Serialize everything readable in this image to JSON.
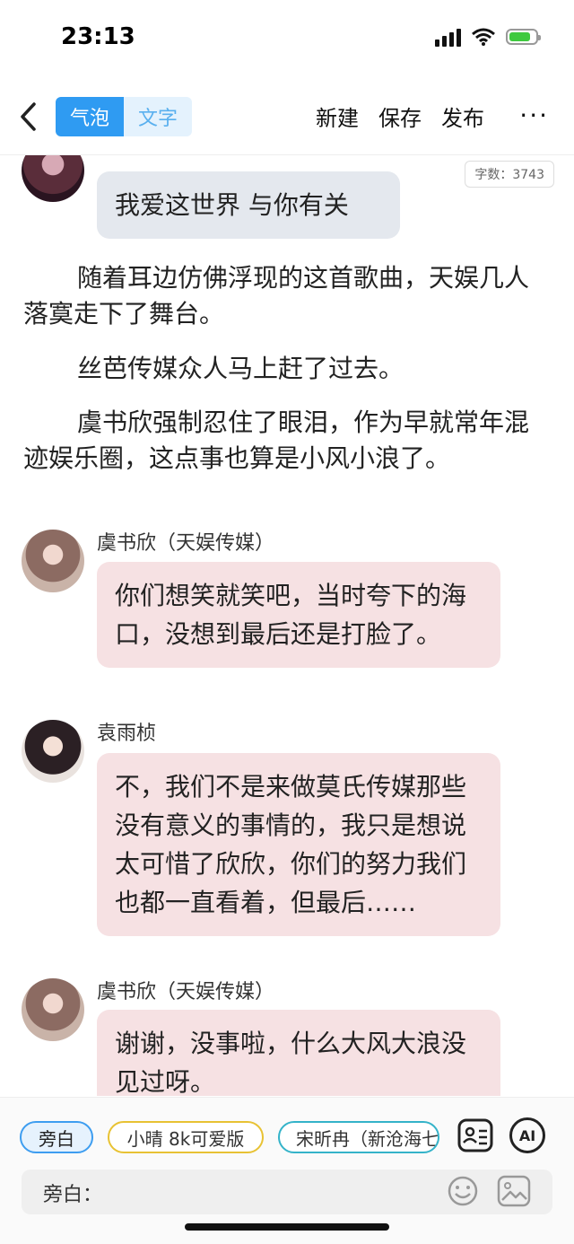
{
  "status": {
    "time": "23:13"
  },
  "header": {
    "seg_bubble": "气泡",
    "seg_text": "文字",
    "new_label": "新建",
    "save_label": "保存",
    "publish_label": "发布",
    "more_label": "···"
  },
  "word_count": "字数：3743",
  "messages": [
    {
      "bubble": "我爱这世界 与你有关"
    },
    {
      "name": "虞书欣（天娱传媒）",
      "text": "你们想笑就笑吧，当时夸下的海口，没想到最后还是打脸了。"
    },
    {
      "name": "袁雨桢",
      "text": "不，我们不是来做莫氏传媒那些没有意义的事情的，我只是想说太可惜了欣欣，你们的努力我们也都一直看着，但最后……"
    },
    {
      "name": "虞书欣（天娱传媒）",
      "text": "谢谢，没事啦，什么大风大浪没见过呀。"
    }
  ],
  "paragraphs": [
    "随着耳边仿佛浮现的这首歌曲，天娱几人落寞走下了舞台。",
    "丝芭传媒众人马上赶了过去。",
    "虞书欣强制忍住了眼泪，作为早就常年混迹娱乐圈，这点事也算是小风小浪了。"
  ],
  "bottom": {
    "chips": [
      "旁白",
      "小晴 8k可爱版",
      "宋昕冉（新沧海七"
    ],
    "ai_label": "AI",
    "input_label": "旁白："
  },
  "colors": {
    "accent": "#2f9bf2",
    "bubble_grey": "#e4e8ee",
    "bubble_pink": "#f6e1e3"
  }
}
